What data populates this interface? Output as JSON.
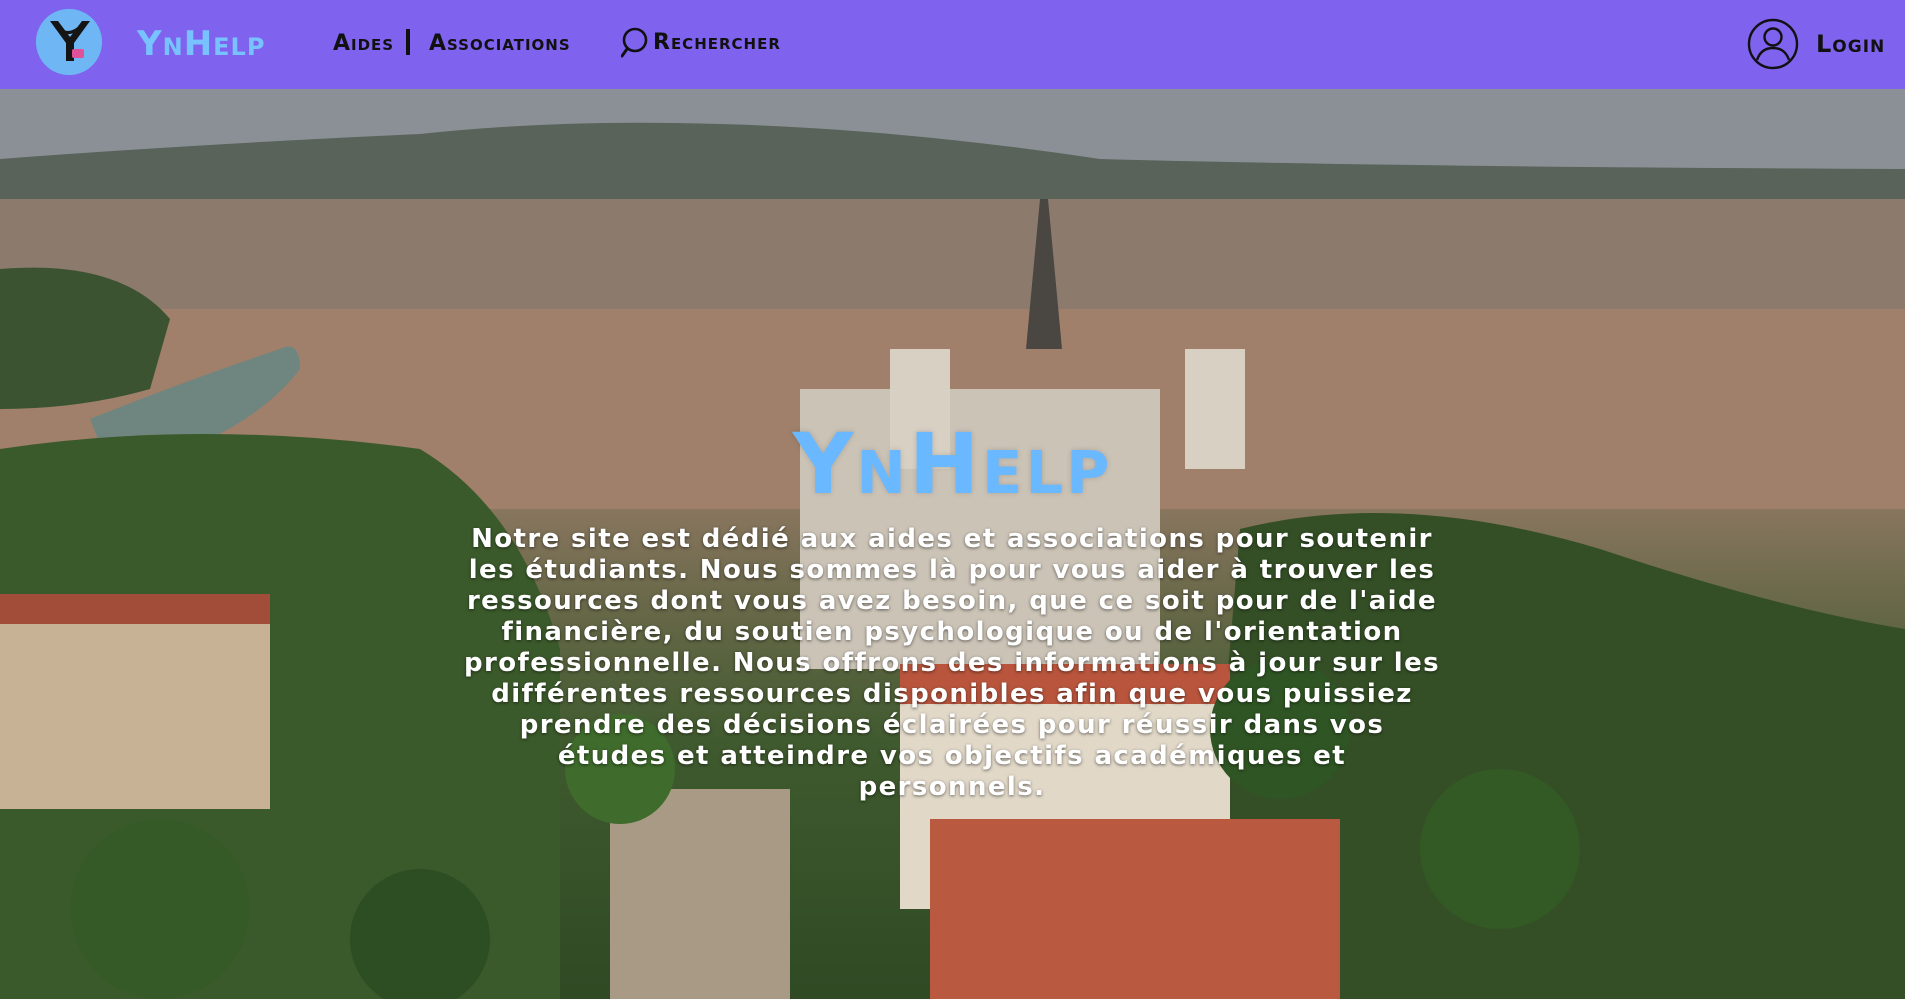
{
  "header": {
    "brand": "YnHelp",
    "nav": {
      "aides": "Aides",
      "associations": "Associations"
    },
    "search_label": "Rechercher",
    "login_label": "Login"
  },
  "hero": {
    "title": "YnHelp",
    "description": "Notre site est dédié aux aides et associations pour soutenir les étudiants. Nous sommes là pour vous aider à trouver les ressources dont vous avez besoin, que ce soit pour de l'aide financière, du soutien psychologique ou de l'orientation professionnelle. Nous offrons des informations à jour sur les différentes ressources disponibles afin que vous puissiez prendre des décisions éclairées pour réussir dans vos études et atteindre vos objectifs académiques et personnels."
  },
  "colors": {
    "navbar": "#7f63ef",
    "brand": "#78c2ff",
    "hero_title": "#6ab8ff",
    "text": "#ffffff"
  },
  "icons": {
    "logo": "ynhelp-logo",
    "search": "search-icon",
    "user": "user-icon"
  }
}
